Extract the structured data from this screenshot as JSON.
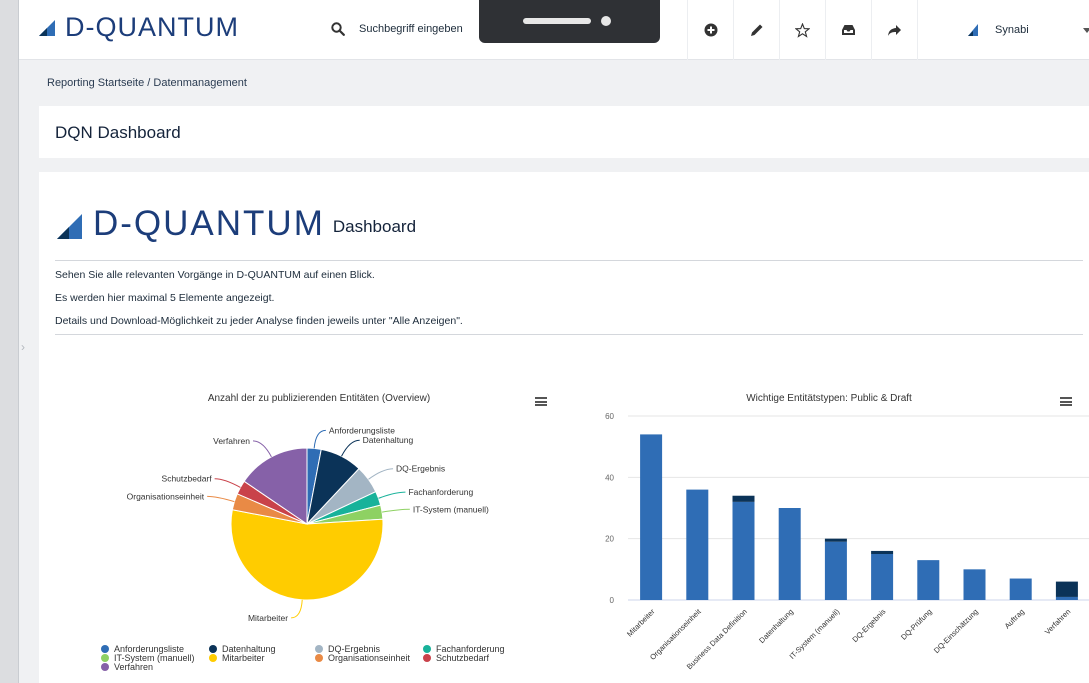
{
  "app": {
    "logo_text": "D-QUANTUM",
    "search_placeholder": "Suchbegriff eingeben",
    "user_name": "Synabi",
    "brand_color": "#1c3d7a"
  },
  "toolbar": {
    "icons": [
      "plus-circle-icon",
      "pencil-icon",
      "star-icon",
      "inbox-icon",
      "share-icon"
    ]
  },
  "breadcrumb": "Reporting Startseite / Datenmanagement",
  "page_title": "DQN Dashboard",
  "hero": {
    "logo_text": "D-QUANTUM",
    "subtitle": "Dashboard"
  },
  "intro": {
    "line1": "Sehen Sie alle relevanten Vorgänge in D-QUANTUM auf einen Blick.",
    "line2": "Es werden hier maximal 5 Elemente angezeigt.",
    "line3": "Details und Download-Möglichkeit zu jeder Analyse finden jeweils unter \"Alle Anzeigen\"."
  },
  "chart_data": [
    {
      "type": "pie",
      "title": "Anzahl der zu publizierenden Entitäten (Overview)",
      "slices": [
        {
          "name": "Anforderungsliste",
          "value": 3,
          "color": "#2f6db5"
        },
        {
          "name": "Datenhaltung",
          "value": 9,
          "color": "#0b3358"
        },
        {
          "name": "DQ-Ergebnis",
          "value": 6,
          "color": "#a3b5c4"
        },
        {
          "name": "Fachanforderung",
          "value": 3,
          "color": "#18b29a"
        },
        {
          "name": "IT-System (manuell)",
          "value": 3,
          "color": "#8ed163"
        },
        {
          "name": "Mitarbeiter",
          "value": 54,
          "color": "#ffcc00"
        },
        {
          "name": "Organisationseinheit",
          "value": 3.5,
          "color": "#e98a45"
        },
        {
          "name": "Schutzbedarf",
          "value": 3,
          "color": "#c9424a"
        },
        {
          "name": "Verfahren",
          "value": 15.5,
          "color": "#8661a8"
        }
      ],
      "legend": "bottom"
    },
    {
      "type": "bar",
      "title": "Wichtige Entitätstypen: Public & Draft",
      "categories": [
        "Mitarbeiter",
        "Organisationseinheit",
        "Business Data Definition",
        "Datenhaltung",
        "IT-System (manuell)",
        "DQ-Ergebnis",
        "DQ-Prüfung",
        "DQ-Einschätzung",
        "Auftrag",
        "Verfahren"
      ],
      "series": [
        {
          "values": [
            54,
            36,
            32,
            30,
            19,
            15,
            13,
            10,
            7,
            1
          ],
          "color": "#2f6db5"
        },
        {
          "values": [
            0,
            0,
            2,
            0,
            1,
            1,
            0,
            0,
            0,
            5
          ],
          "color": "#0b3358"
        }
      ],
      "yticks": [
        0,
        20,
        40,
        60
      ],
      "ylim": [
        0,
        60
      ],
      "stacked": true
    }
  ]
}
